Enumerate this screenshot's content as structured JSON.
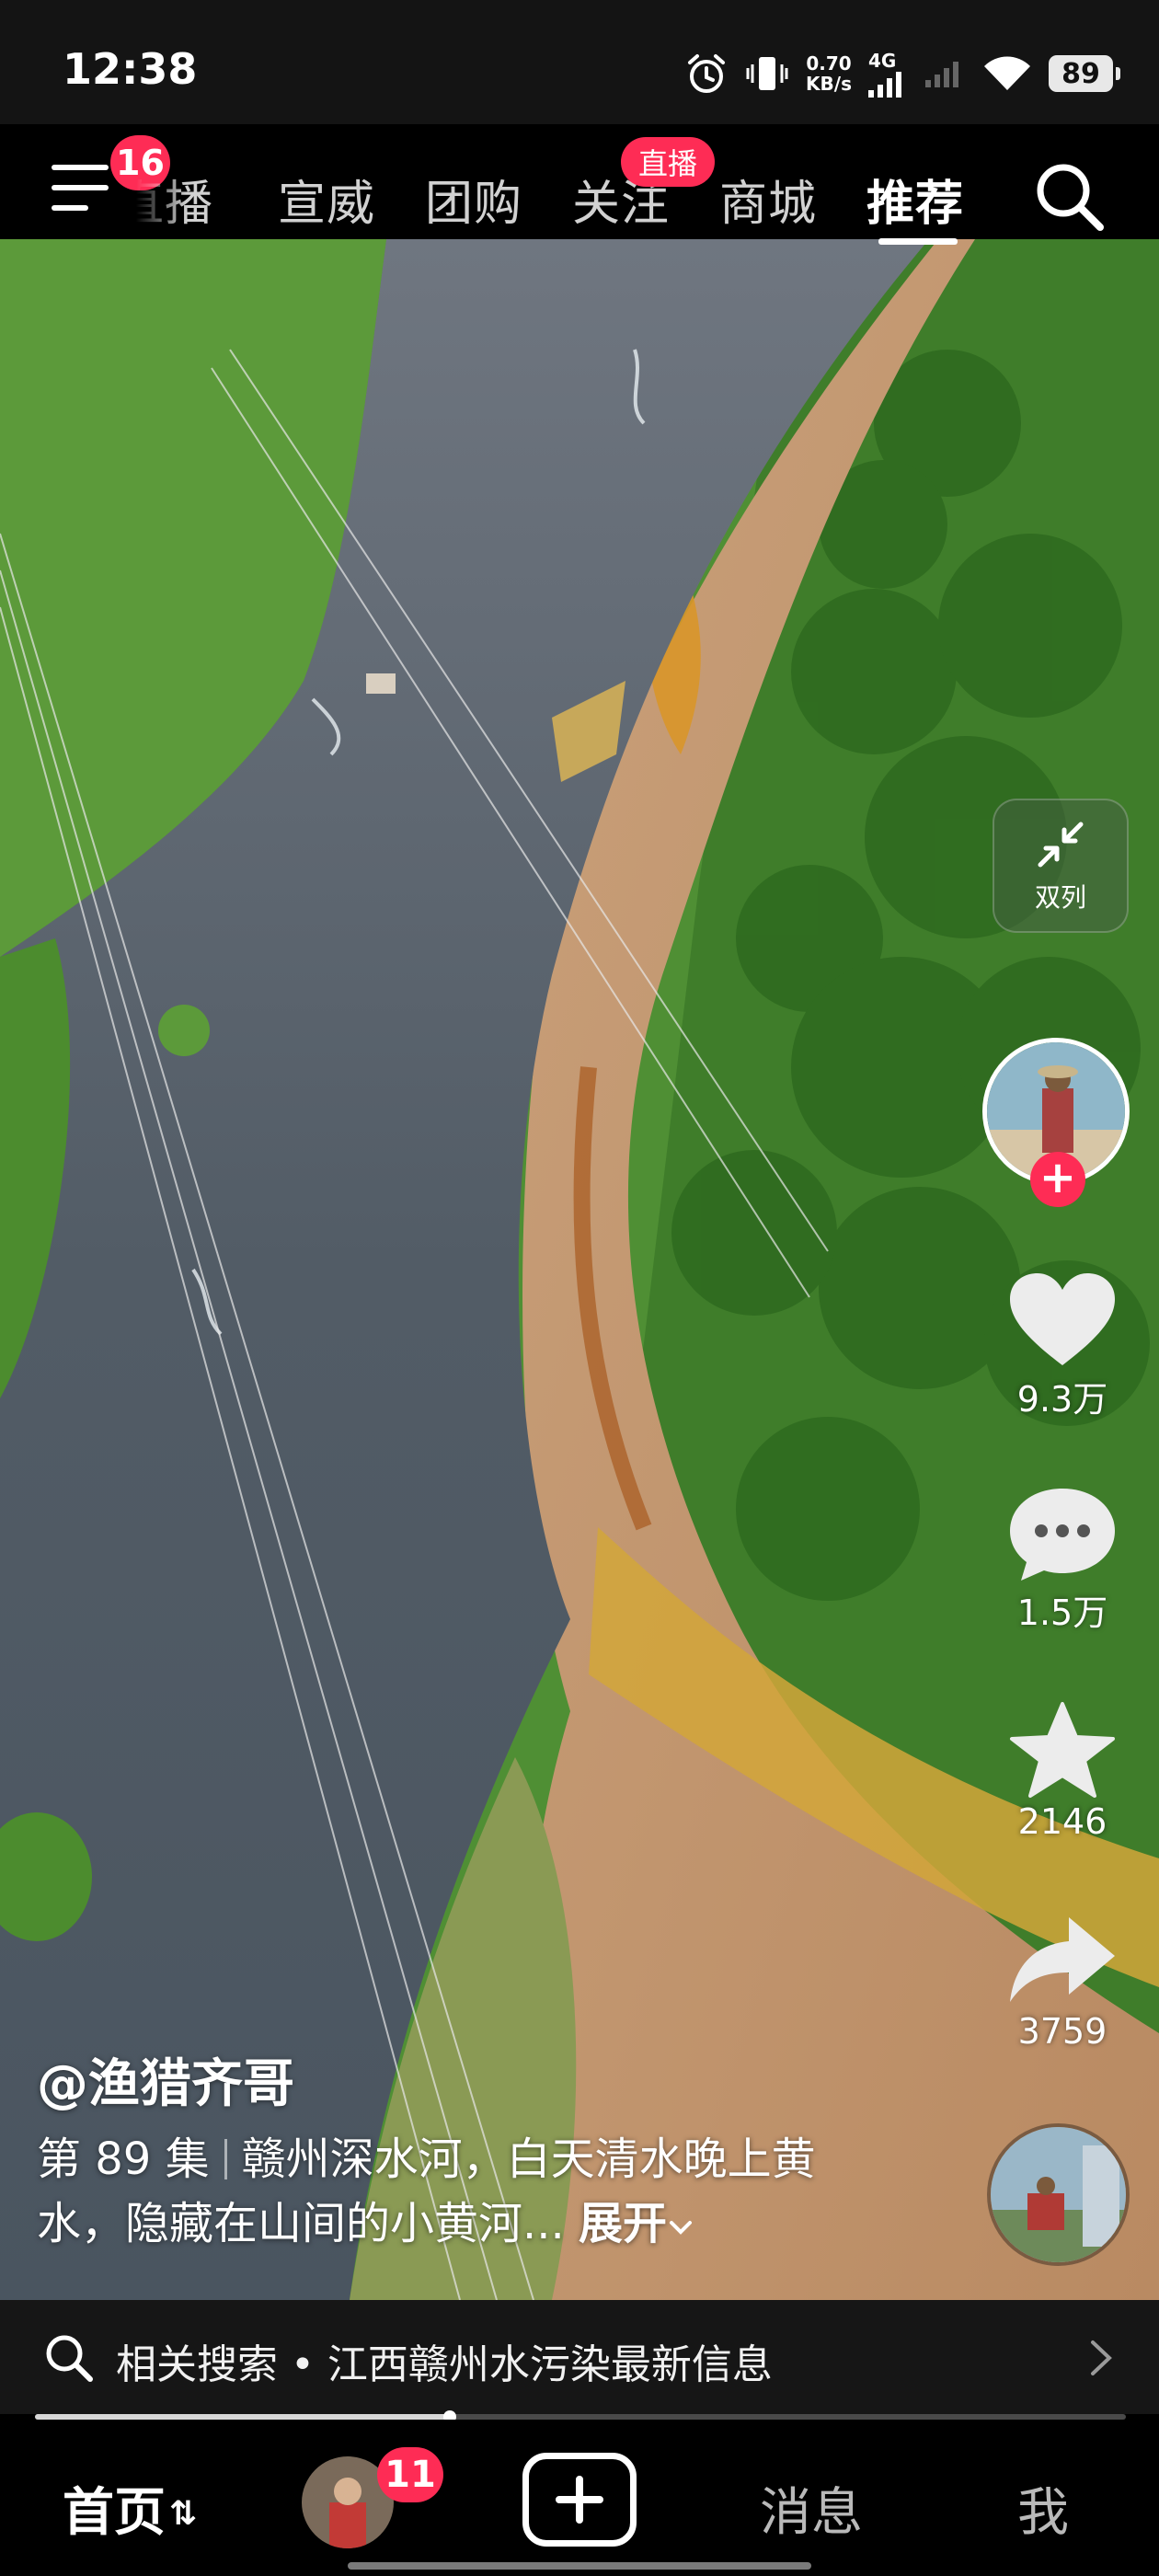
{
  "status_bar": {
    "time": "12:38",
    "net_speed_value": "0.70",
    "net_speed_unit": "KB/s",
    "network": "4G",
    "battery": "89",
    "icons": [
      "alarm-icon",
      "vibrate-icon",
      "signal-icon",
      "wifi-icon",
      "battery-icon"
    ]
  },
  "top_nav": {
    "menu_badge": "16",
    "tabs": [
      {
        "label": "直播",
        "active": false
      },
      {
        "label": "宣威",
        "active": false
      },
      {
        "label": "团购",
        "active": false
      },
      {
        "label": "关注",
        "active": false,
        "badge": "直播"
      },
      {
        "label": "商城",
        "active": false
      },
      {
        "label": "推荐",
        "active": true
      }
    ]
  },
  "right_rail": {
    "dual_column_label": "双列",
    "like_count": "9.3万",
    "comment_count": "1.5万",
    "favorite_count": "2146",
    "share_count": "3759"
  },
  "video_info": {
    "author": "@渔猎齐哥",
    "episode": "第 89 集",
    "caption": "赣州深水河，白天清水晚上黄水，隐藏在山间的小黄河...",
    "expand_label": "展开"
  },
  "related_search": {
    "text": "相关搜索 • 江西赣州水污染最新信息"
  },
  "playback": {
    "progress_fraction": 0.38
  },
  "bottom_nav": {
    "home_label": "首页",
    "friends_badge": "11",
    "messages_label": "消息",
    "me_label": "我"
  },
  "colors": {
    "accent": "#fe2c55",
    "background": "#000000"
  }
}
